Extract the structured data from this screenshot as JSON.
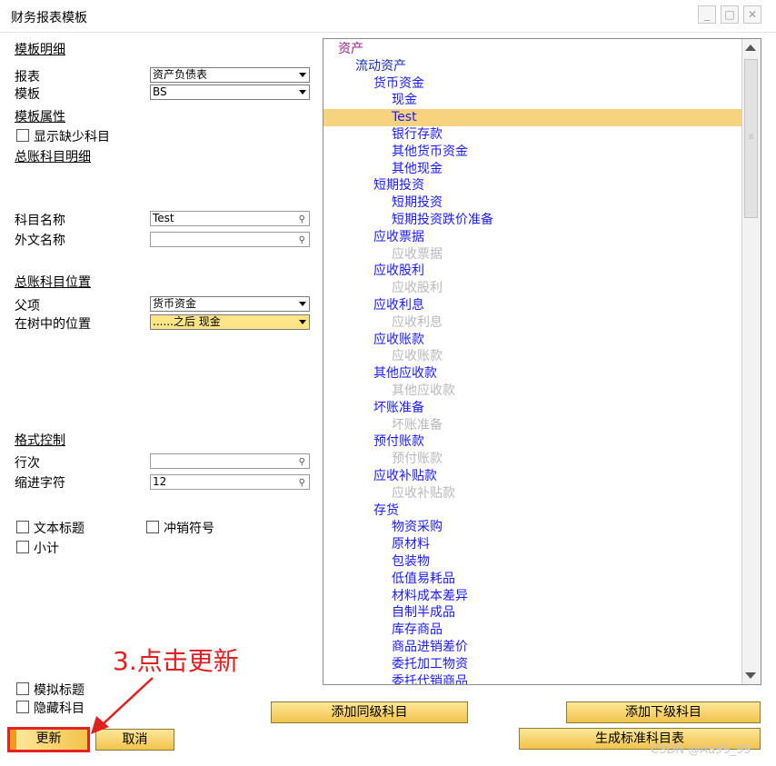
{
  "window": {
    "title": "财务报表模板",
    "minimize_icon": "minimize-icon",
    "maximize_icon": "maximize-icon",
    "close_icon": "close-icon",
    "minimize_glyph": "_",
    "maximize_glyph": "□",
    "close_glyph": "✕"
  },
  "left": {
    "section_template_detail": "模板明细",
    "report_label": "报表",
    "report_value": "资产负债表",
    "template_label": "模板",
    "template_value": "BS",
    "section_template_props": "模板属性",
    "show_missing_label": "显示缺少科目",
    "section_gl_detail": "总账科目明细",
    "account_name_label": "科目名称",
    "account_name_value": "Test",
    "foreign_name_label": "外文名称",
    "foreign_name_value": "",
    "section_gl_position": "总账科目位置",
    "parent_label": "父项",
    "parent_value": "货币资金",
    "tree_position_label": "在树中的位置",
    "tree_position_value": "......之后 现金",
    "section_format": "格式控制",
    "row_label": "行次",
    "row_value": "",
    "indent_label": "缩进字符",
    "indent_value": "12",
    "text_title_label": "文本标题",
    "reversal_label": "冲销符号",
    "subtotal_label": "小计",
    "dummy_title_label": "模拟标题",
    "hide_account_label": "隐藏科目",
    "link_glyph": "⚲"
  },
  "tree": {
    "items": [
      {
        "label": "资产",
        "color": "#9b1f8f",
        "level": 0
      },
      {
        "label": "流动资产",
        "color": "#1a2fb0",
        "level": 1
      },
      {
        "label": "货币资金",
        "color": "#1a1aff",
        "level": 2
      },
      {
        "label": "现金",
        "color": "#1a1aff",
        "level": 3
      },
      {
        "label": "Test",
        "color": "#1a1aff",
        "level": 3,
        "selected": true
      },
      {
        "label": "银行存款",
        "color": "#1a1aff",
        "level": 3
      },
      {
        "label": "其他货币资金",
        "color": "#1a1aff",
        "level": 3
      },
      {
        "label": "其他现金",
        "color": "#1a1aff",
        "level": 3
      },
      {
        "label": "短期投资",
        "color": "#1a1aff",
        "level": 2
      },
      {
        "label": "短期投资",
        "color": "#1a1aff",
        "level": 3
      },
      {
        "label": "短期投资跌价准备",
        "color": "#1a1aff",
        "level": 3
      },
      {
        "label": "应收票据",
        "color": "#1a1aff",
        "level": 2
      },
      {
        "label": "应收票据",
        "color": "#b8b8b8",
        "level": 3
      },
      {
        "label": "应收股利",
        "color": "#1a1aff",
        "level": 2
      },
      {
        "label": "应收股利",
        "color": "#b8b8b8",
        "level": 3
      },
      {
        "label": "应收利息",
        "color": "#1a1aff",
        "level": 2
      },
      {
        "label": "应收利息",
        "color": "#b8b8b8",
        "level": 3
      },
      {
        "label": "应收账款",
        "color": "#1a1aff",
        "level": 2
      },
      {
        "label": "应收账款",
        "color": "#b8b8b8",
        "level": 3
      },
      {
        "label": "其他应收款",
        "color": "#1a1aff",
        "level": 2
      },
      {
        "label": "其他应收款",
        "color": "#b8b8b8",
        "level": 3
      },
      {
        "label": "坏账准备",
        "color": "#1a1aff",
        "level": 2
      },
      {
        "label": "坏账准备",
        "color": "#b8b8b8",
        "level": 3
      },
      {
        "label": "预付账款",
        "color": "#1a1aff",
        "level": 2
      },
      {
        "label": "预付账款",
        "color": "#b8b8b8",
        "level": 3
      },
      {
        "label": "应收补贴款",
        "color": "#1a1aff",
        "level": 2
      },
      {
        "label": "应收补贴款",
        "color": "#b8b8b8",
        "level": 3
      },
      {
        "label": "存货",
        "color": "#1a1aff",
        "level": 2
      },
      {
        "label": "物资采购",
        "color": "#1a1aff",
        "level": 3
      },
      {
        "label": "原材料",
        "color": "#1a1aff",
        "level": 3
      },
      {
        "label": "包装物",
        "color": "#1a1aff",
        "level": 3
      },
      {
        "label": "低值易耗品",
        "color": "#1a1aff",
        "level": 3
      },
      {
        "label": "材料成本差异",
        "color": "#1a1aff",
        "level": 3
      },
      {
        "label": "自制半成品",
        "color": "#1a1aff",
        "level": 3
      },
      {
        "label": "库存商品",
        "color": "#1a1aff",
        "level": 3
      },
      {
        "label": "商品进销差价",
        "color": "#1a1aff",
        "level": 3
      },
      {
        "label": "委托加工物资",
        "color": "#1a1aff",
        "level": 3
      },
      {
        "label": "委托代销商品",
        "color": "#1a1aff",
        "level": 3
      }
    ]
  },
  "buttons": {
    "add_same_level": "添加同级科目",
    "add_sub_level": "添加下级科目",
    "update": "更新",
    "cancel": "取消",
    "generate_standard": "生成标准科目表"
  },
  "annotation": {
    "text": "3.点击更新",
    "color": "#e02020"
  },
  "watermark": "CSDN @Aa99_99"
}
